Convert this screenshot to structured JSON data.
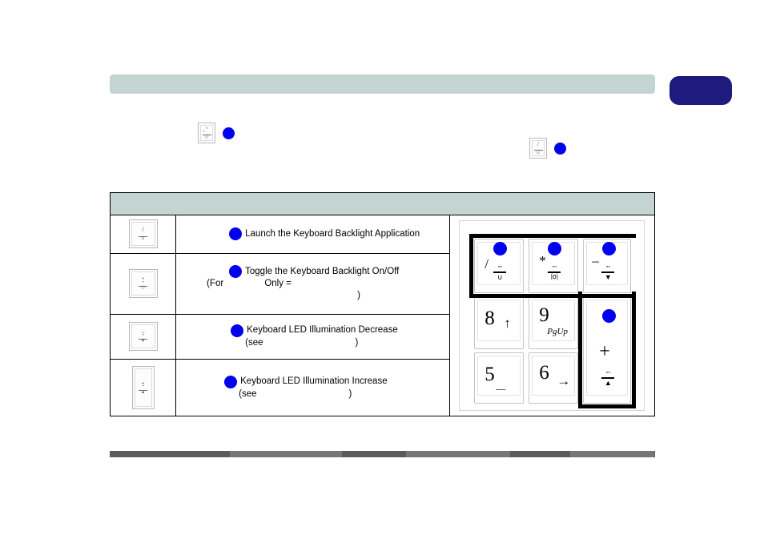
{
  "document": {
    "type": "manual-page",
    "header_bar_color": "#c3d4d1",
    "chapter_tab_color": "#1d1b7e",
    "footer_bar_color": "#5b5b5b",
    "bullet_color": "#0000ee"
  },
  "inline_notes": [
    {
      "key_glyph_top": "*",
      "key_glyph_bottom": "lamp-toggle",
      "dot": "blue-bullet"
    },
    {
      "key_glyph_top": "/",
      "key_glyph_bottom": "lamp-launch",
      "dot": "blue-bullet"
    }
  ],
  "table": {
    "header_label": "",
    "columns": [
      "key",
      "description",
      "keypad-illustration"
    ],
    "rows": [
      {
        "key_glyph": {
          "top": "/",
          "bottom": "lamp-launch"
        },
        "lines": [
          {
            "bullet": true,
            "text": "Launch the Keyboard Backlight Application",
            "indent": "indent-1",
            "hidden": false
          }
        ]
      },
      {
        "key_glyph": {
          "top": "*",
          "bottom": "lamp-toggle"
        },
        "lines": [
          {
            "bullet": true,
            "text": "Toggle the Keyboard Backlight On/Off",
            "indent": "indent-2",
            "hidden": false
          },
          {
            "bullet": false,
            "text": "(For                Only =",
            "indent": "indent-3",
            "hidden": false
          },
          {
            "bullet": false,
            "text": ")",
            "indent": "indent-4",
            "hidden": false
          }
        ]
      },
      {
        "key_glyph": {
          "top": "–",
          "bottom": "lamp-decrease"
        },
        "lines": [
          {
            "bullet": true,
            "text": "Keyboard LED Illumination Decrease",
            "indent": "indent-5",
            "hidden": false
          },
          {
            "bullet": false,
            "text": "(see                                    )",
            "indent": "indent-6",
            "hidden": false
          }
        ]
      },
      {
        "key_glyph": {
          "top": "+",
          "bottom": "lamp-increase"
        },
        "lines": [
          {
            "bullet": true,
            "text": "Keyboard LED Illumination Increase",
            "indent": "indent-7",
            "hidden": false
          },
          {
            "bullet": false,
            "text": "(see                                    )",
            "indent": "indent-8",
            "hidden": false
          }
        ]
      }
    ]
  },
  "keypad": {
    "caption": "numeric keypad illustration",
    "keys": [
      {
        "id": "slash",
        "main": "/",
        "icon": "keyboard-backlight-launch",
        "icon_sym": "∪",
        "dot": true
      },
      {
        "id": "asterisk",
        "main": "*",
        "icon": "keyboard-backlight-toggle",
        "icon_sym": "⒪",
        "dot": true
      },
      {
        "id": "minus",
        "main": "–",
        "icon": "keyboard-backlight-decrease",
        "icon_sym": "▼",
        "dot": true
      },
      {
        "id": "eight",
        "main": "8",
        "sub": "↑",
        "dot": false
      },
      {
        "id": "nine",
        "main": "9",
        "sub": "PgUp",
        "dot": false
      },
      {
        "id": "plus",
        "main": "+",
        "icon": "keyboard-backlight-increase",
        "icon_sym": "▲",
        "dot": true
      },
      {
        "id": "five",
        "main": "5",
        "sub": "—",
        "dot": false
      },
      {
        "id": "six",
        "main": "6",
        "sub": "→",
        "dot": false
      }
    ]
  }
}
